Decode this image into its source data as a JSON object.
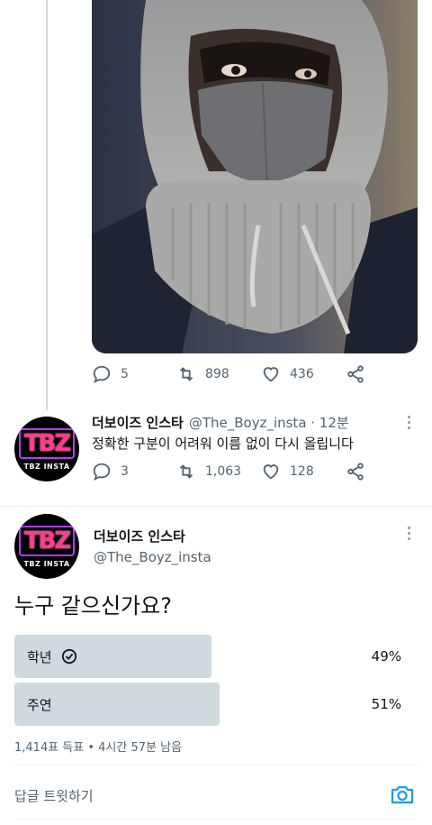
{
  "photo_tweet": {
    "stats": {
      "replies": "5",
      "retweets": "898",
      "likes": "436"
    }
  },
  "tweet1": {
    "avatar_brand": "TBZ INSTA",
    "avatar_logo": "TBZ",
    "name": "더보이즈 인스타",
    "handle": "@The_Boyz_insta · 12분",
    "text": "정확한 구분이 어려워 이름 없이 다시 올립니다",
    "stats": {
      "replies": "3",
      "retweets": "1,063",
      "likes": "128"
    }
  },
  "tweet2": {
    "avatar_brand": "TBZ INSTA",
    "avatar_logo": "TBZ",
    "name": "더보이즈 인스타",
    "handle": "@The_Boyz_insta",
    "text": "누구 같으신가요?",
    "poll": {
      "options": [
        {
          "label": "학년",
          "percent": "49%",
          "share": 0.49,
          "selected": true
        },
        {
          "label": "주연",
          "percent": "51%",
          "share": 0.51,
          "selected": false
        }
      ],
      "meta": "1,414표 득표 • 4시간 57분 남음"
    }
  },
  "reply_bar": {
    "placeholder": "답글 트윗하기"
  },
  "colors": {
    "accent": "#1d9bf0",
    "muted": "#536471",
    "bar": "#cfd9de"
  },
  "icons": [
    "reply-icon",
    "retweet-icon",
    "like-icon",
    "share-icon",
    "more-icon",
    "check-circle-icon",
    "camera-icon"
  ]
}
